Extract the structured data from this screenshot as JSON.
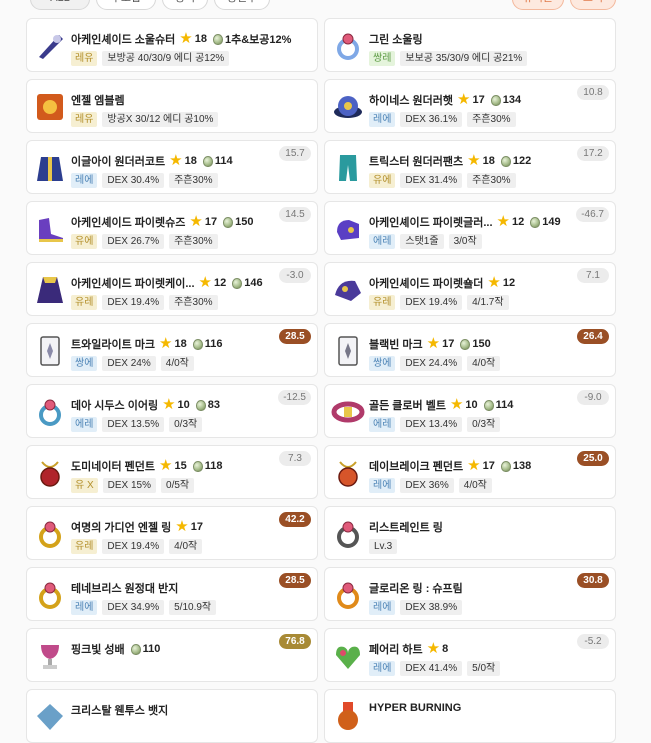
{
  "top_pills": [
    "ALL",
    "무보합",
    "장비",
    "장신구",
    "유니온",
    "코디"
  ],
  "colors": {
    "star": "#f5b800",
    "score_brown": "#9a4f25",
    "score_gold": "#a88a35",
    "score_gray": "#ececec"
  },
  "items": [
    {
      "name": "아케인셰이드 소울슈터",
      "stars": "18",
      "starforce": "",
      "extra": "1추&보공12%",
      "tier": "레유",
      "tier_color": "gold",
      "stats": [
        "보방공 40/30/9 에디 공12%"
      ],
      "score": "",
      "icon": "soul-shooter-icon",
      "icon_color": "#3a3b8c"
    },
    {
      "name": "그린 소울링",
      "stars": "",
      "starforce": "",
      "extra": "",
      "tier": "쌍레",
      "tier_color": "green",
      "stats": [
        "보보공 35/30/9 에디 공21%"
      ],
      "score": "",
      "icon": "soul-ring-icon",
      "icon_color": "#7fa8e6"
    },
    {
      "name": "엔젤 엠블렘",
      "stars": "",
      "starforce": "",
      "extra": "",
      "tier": "레유",
      "tier_color": "gold",
      "stats": [
        "방공X 30/12 에디 공10%"
      ],
      "score": "",
      "icon": "emblem-icon",
      "icon_color": "#d25a1c"
    },
    {
      "name": "하이네스 원더러햇",
      "stars": "17",
      "starforce": "134",
      "extra": "",
      "tier": "레에",
      "tier_color": "blue",
      "stats": [
        "DEX 36.1%",
        "주흔30%"
      ],
      "score": "10.8",
      "score_style": "gray",
      "icon": "hat-icon",
      "icon_color": "#4c62c4"
    },
    {
      "name": "이글아이 원더러코트",
      "stars": "18",
      "starforce": "114",
      "extra": "",
      "tier": "레에",
      "tier_color": "blue",
      "stats": [
        "DEX 30.4%",
        "주흔30%"
      ],
      "score": "15.7",
      "score_style": "gray",
      "icon": "coat-icon",
      "icon_color": "#2c3e8f"
    },
    {
      "name": "트릭스터 원더러팬츠",
      "stars": "18",
      "starforce": "122",
      "extra": "",
      "tier": "유에",
      "tier_color": "gold",
      "stats": [
        "DEX 31.4%",
        "주흔30%"
      ],
      "score": "17.2",
      "score_style": "gray",
      "icon": "pants-icon",
      "icon_color": "#2a9a9e"
    },
    {
      "name": "아케인셰이드 파이렛슈즈",
      "stars": "17",
      "starforce": "150",
      "extra": "",
      "tier": "유에",
      "tier_color": "gold",
      "stats": [
        "DEX 26.7%",
        "주흔30%"
      ],
      "score": "14.5",
      "score_style": "gray",
      "icon": "shoes-icon",
      "icon_color": "#6a3fbf"
    },
    {
      "name": "아케인셰이드 파이렛글러...",
      "stars": "12",
      "starforce": "149",
      "extra": "",
      "tier": "에레",
      "tier_color": "blue",
      "stats": [
        "스탯1줄",
        "3/0작"
      ],
      "score": "-46.7",
      "score_style": "gray",
      "icon": "glove-icon",
      "icon_color": "#5a3fc4"
    },
    {
      "name": "아케인셰이드 파이렛케이...",
      "stars": "12",
      "starforce": "146",
      "extra": "",
      "tier": "유레",
      "tier_color": "gold",
      "stats": [
        "DEX 19.4%",
        "주흔30%"
      ],
      "score": "-3.0",
      "score_style": "gray",
      "icon": "cape-icon",
      "icon_color": "#3a2a7a"
    },
    {
      "name": "아케인셰이드 파이렛숄더",
      "stars": "12",
      "starforce": "",
      "extra": "",
      "tier": "유레",
      "tier_color": "gold",
      "stats": [
        "DEX 19.4%",
        "4/1.7작"
      ],
      "score": "7.1",
      "score_style": "gray",
      "icon": "shoulder-icon",
      "icon_color": "#4a3a9a"
    },
    {
      "name": "트와일라이트 마크",
      "stars": "18",
      "starforce": "116",
      "extra": "",
      "tier": "쌍에",
      "tier_color": "blue",
      "stats": [
        "DEX 24%",
        "4/0작"
      ],
      "score": "28.5",
      "score_style": "brown",
      "icon": "mark-icon",
      "icon_color": "#8a8aa8"
    },
    {
      "name": "블랙빈 마크",
      "stars": "17",
      "starforce": "150",
      "extra": "",
      "tier": "쌍에",
      "tier_color": "blue",
      "stats": [
        "DEX 24.4%",
        "4/0작"
      ],
      "score": "26.4",
      "score_style": "brown",
      "icon": "black-mark-icon",
      "icon_color": "#777788"
    },
    {
      "name": "데아 시두스 이어링",
      "stars": "10",
      "starforce": "83",
      "extra": "",
      "tier": "에레",
      "tier_color": "blue",
      "stats": [
        "DEX 13.5%",
        "0/3작"
      ],
      "score": "-12.5",
      "score_style": "gray",
      "icon": "earring-icon",
      "icon_color": "#4a9ac4"
    },
    {
      "name": "골든 클로버 벨트",
      "stars": "10",
      "starforce": "114",
      "extra": "",
      "tier": "에레",
      "tier_color": "blue",
      "stats": [
        "DEX 13.4%",
        "0/3작"
      ],
      "score": "-9.0",
      "score_style": "gray",
      "icon": "belt-icon",
      "icon_color": "#b03a6a"
    },
    {
      "name": "도미네이터 펜던트",
      "stars": "15",
      "starforce": "118",
      "extra": "",
      "tier": "유 X",
      "tier_color": "gold",
      "stats": [
        "DEX 15%",
        "0/5작"
      ],
      "score": "7.3",
      "score_style": "gray",
      "icon": "pendant-icon",
      "icon_color": "#b0242a"
    },
    {
      "name": "데이브레이크 펜던트",
      "stars": "17",
      "starforce": "138",
      "extra": "",
      "tier": "레에",
      "tier_color": "blue",
      "stats": [
        "DEX 36%",
        "4/0작"
      ],
      "score": "25.0",
      "score_style": "brown",
      "icon": "daybreak-pendant-icon",
      "icon_color": "#d6552a"
    },
    {
      "name": "여명의 가디언 엔젤 링",
      "stars": "17",
      "starforce": "",
      "extra": "",
      "tier": "유레",
      "tier_color": "gold",
      "stats": [
        "DEX 19.4%",
        "4/0작"
      ],
      "score": "42.2",
      "score_style": "brown",
      "icon": "angel-ring-icon",
      "icon_color": "#d4a21a"
    },
    {
      "name": "리스트레인트 링",
      "stars": "",
      "starforce": "",
      "extra": "",
      "tier": "",
      "tier_color": "",
      "stats": [
        "Lv.3"
      ],
      "score": "",
      "icon": "restraint-ring-icon",
      "icon_color": "#555555"
    },
    {
      "name": "테네브리스 원정대 반지",
      "stars": "",
      "starforce": "",
      "extra": "",
      "tier": "레에",
      "tier_color": "blue",
      "stats": [
        "DEX 34.9%",
        "5/10.9작"
      ],
      "score": "28.5",
      "score_style": "brown",
      "icon": "tenebris-ring-icon",
      "icon_color": "#d4a21a"
    },
    {
      "name": "글로리온 링 : 슈프림",
      "stars": "",
      "starforce": "",
      "extra": "",
      "tier": "레에",
      "tier_color": "blue",
      "stats": [
        "DEX 38.9%"
      ],
      "score": "30.8",
      "score_style": "brown",
      "icon": "glorion-ring-icon",
      "icon_color": "#e08a1a"
    },
    {
      "name": "핑크빛 성배",
      "stars": "",
      "starforce": "110",
      "extra": "",
      "tier": "",
      "tier_color": "",
      "stats": [],
      "score": "76.8",
      "score_style": "gold",
      "icon": "chalice-icon",
      "icon_color": "#c04a8a"
    },
    {
      "name": "페어리 하트",
      "stars": "8",
      "starforce": "",
      "extra": "",
      "tier": "레에",
      "tier_color": "blue",
      "stats": [
        "DEX 41.4%",
        "5/0작"
      ],
      "score": "-5.2",
      "score_style": "gray",
      "icon": "fairy-heart-icon",
      "icon_color": "#5ab04a"
    },
    {
      "name": "크리스탈 웬투스 뱃지",
      "stars": "",
      "starforce": "",
      "extra": "",
      "tier": "",
      "tier_color": "",
      "stats": [],
      "score": "",
      "icon": "badge-icon",
      "icon_color": "#6aa0c8"
    },
    {
      "name": "HYPER BURNING",
      "stars": "",
      "starforce": "",
      "extra": "",
      "tier": "",
      "tier_color": "",
      "stats": [],
      "score": "",
      "icon": "medal-icon",
      "icon_color": "#d0601a"
    }
  ]
}
